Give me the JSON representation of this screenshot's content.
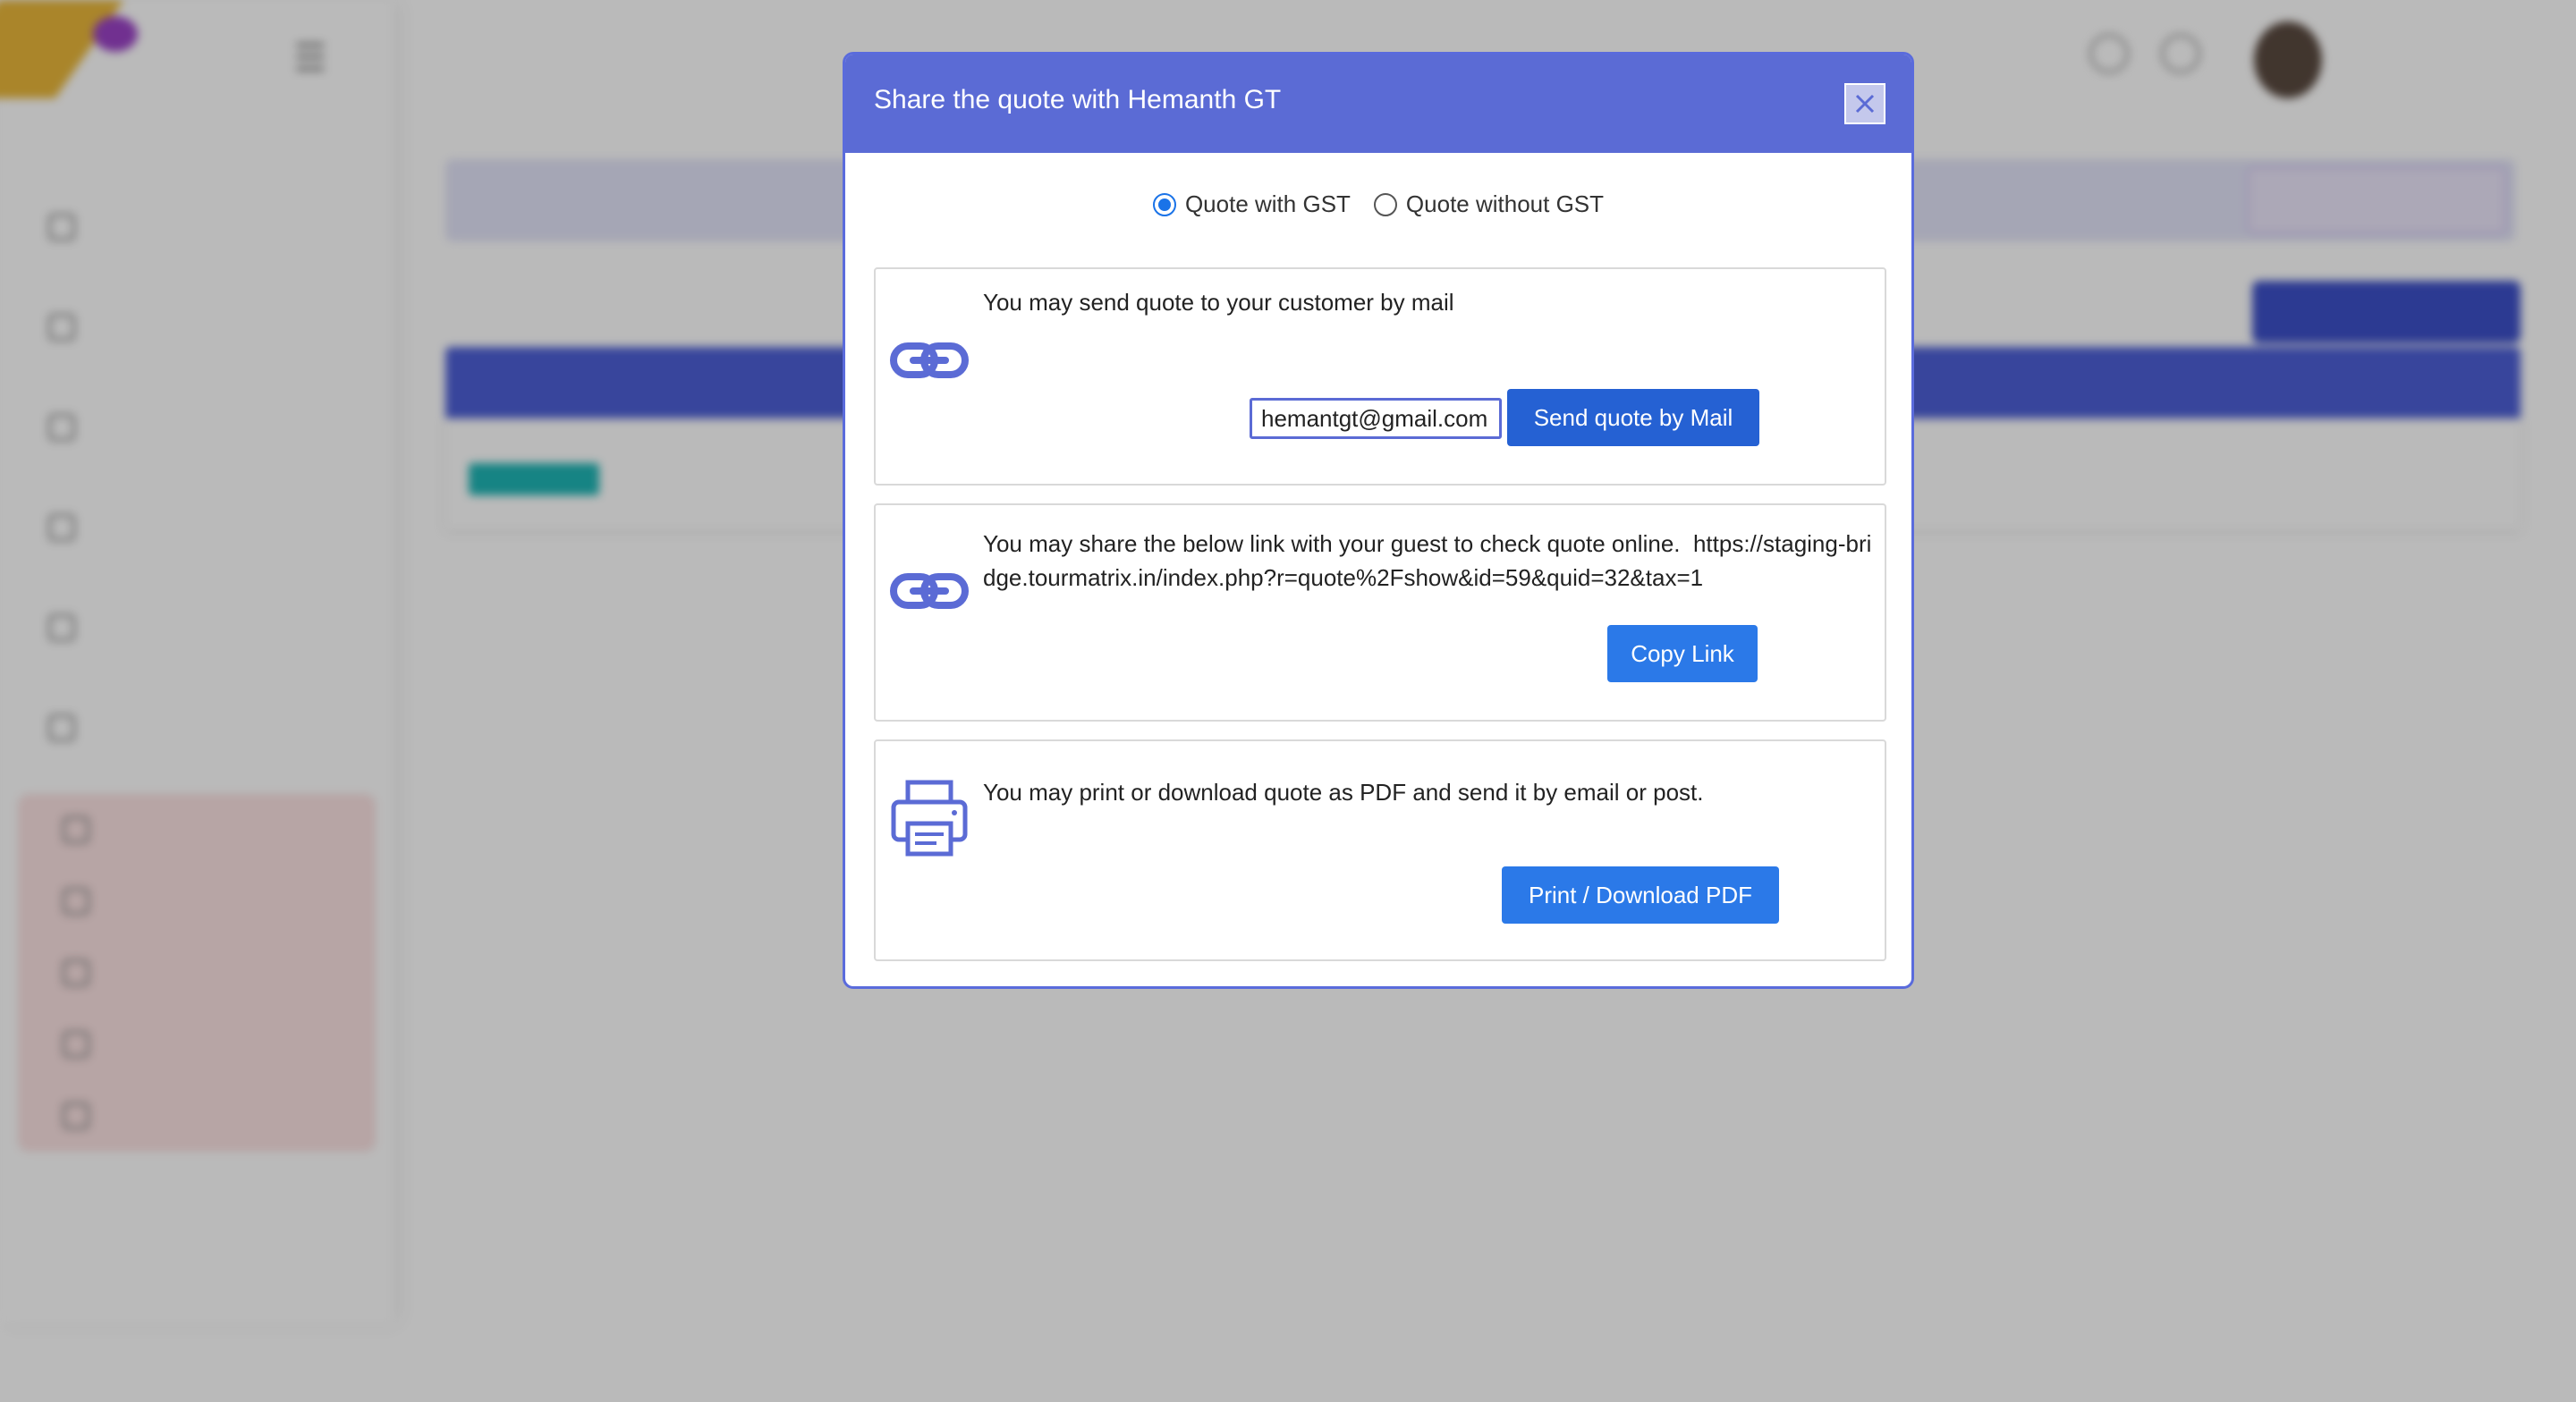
{
  "modal": {
    "title": "Share the quote with Hemanth GT",
    "close_icon": "close-icon",
    "gst_options": [
      {
        "label": "Quote with GST",
        "selected": true
      },
      {
        "label": "Quote without GST",
        "selected": false
      }
    ],
    "mail_card": {
      "icon": "link-icon",
      "text": "You may send quote to your customer by mail",
      "email_value": "hemantgt@gmail.com",
      "button_label": "Send quote by Mail"
    },
    "link_card": {
      "icon": "link-icon",
      "text": "You may share the below link with your guest to check quote online.",
      "url": "https://staging-bridge.tourmatrix.in/index.php?r=quote%2Fshow&id=59&quid=32&tax=1",
      "button_label": "Copy Link"
    },
    "pdf_card": {
      "icon": "printer-icon",
      "text": "You may print or download quote as PDF and send it by email or post.",
      "button_label": "Print / Download PDF"
    }
  },
  "colors": {
    "header": "#5b6bd5",
    "primary_button": "#2b79e8",
    "icon": "#5b6bd5"
  }
}
